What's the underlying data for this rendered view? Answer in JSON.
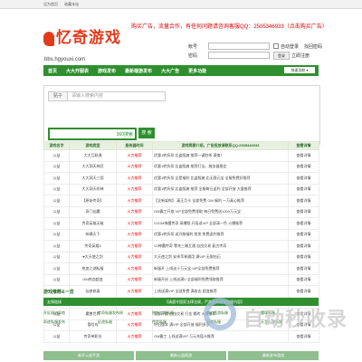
{
  "topbar": {
    "links": [
      "设为首页",
      "收藏本站"
    ]
  },
  "header": {
    "logo_text": "忆奇游戏",
    "domain": "bbs.hgyouxi.com",
    "ad": "购买广告，流量合作，有任何问题请咨询客服QQ：2505346933（点击购买广告）"
  },
  "login": {
    "account_label": "帐号",
    "password_label": "密码",
    "auto_login": "自动登录",
    "forgot": "找回密码",
    "login_button": "登录",
    "register": "立即注册"
  },
  "nav": {
    "items": [
      "首页",
      "大大开服表",
      "游戏发布",
      "最新端游发布",
      "大大广告",
      "更多功能"
    ],
    "quick": "快速导航 ▾"
  },
  "search": {
    "tag": "贴子",
    "placeholder": "请输入搜索内容",
    "engine": "360搜索",
    "button": "搜 索"
  },
  "table": {
    "headers": [
      "游戏名字",
      "游戏类型",
      "服务器时间",
      "游戏简要介绍，广告投放请联系QQ:2505346933",
      "查看详情"
    ],
    "rows": [
      [
        "公益",
        "大大互联通",
        "火力推荐",
        "优惠1转折扣 比盗版爽 推荐一键秒杀 满鬼！",
        "查看详情"
      ],
      [
        "公益",
        "大大洞天神武",
        "火力推荐",
        "优惠1转折扣 比盗版爽 推荐打宝，服务器稳定",
        "查看详情"
      ],
      [
        "公益",
        "大大洞天三国",
        "火力推荐",
        "优惠1转折扣 全是福利 比盗版爽 比无限元宝 全服免费好推荐",
        "查看详情"
      ],
      [
        "公益",
        "大大洞天的神",
        "火力推荐",
        "优惠1转折扣 比盗版爽 推荐 全服每日返利 全部开放 大量推荐",
        "查看详情"
      ],
      [
        "公益",
        "【原始传奇】",
        "火力推荐",
        "【全新架构】 真正月卡 全部免费 GM 福利 一万真心推荐",
        "查看详情"
      ],
      [
        "公益",
        "奇门仙魔",
        "火力推荐",
        "GM霸工开放 VIP全部免费领取 每日免费送1000万元宝",
        "查看详情"
      ],
      [
        "公益",
        "传奇英雄无敌",
        "火力推荐",
        "V2GM神魔传奇 高爆版 开局送VIP 全部清一色 火爆推荐",
        "查看详情"
      ],
      [
        "公益",
        "纵横天下",
        "火力推荐",
        "优惠1转折扣 送开服福利 首发 免费返利推荐",
        "查看详情"
      ],
      [
        "公益",
        "传奇英雄3",
        "火力推荐",
        "V2神魔传奇 零充三端互通 自由交易 复古传奇",
        "查看详情"
      ],
      [
        "公益",
        "♥大天使之剑",
        "火力推荐",
        "大天使之剑 安卓苹果通用 满VIP 无限钻石",
        "查看详情"
      ],
      [
        "公益",
        "热血江湖私服",
        "火力推荐",
        "新服开 上线送十万元宝 VIP全部免费推荐",
        "查看详情"
      ],
      [
        "公益",
        "GM热血超变",
        "火力推荐",
        "新服开启 上线送满V 全部福利免费领取推荐",
        "查看详情"
      ],
      [
        "公益",
        "仙侠修真",
        "火力推荐",
        "上线送满VIP 全部免费 满攻击 超变推荐",
        "查看详情"
      ],
      [
        "公益",
        "原神玩家",
        "火力推荐",
        "【公益优惠】【公益 元宝】【GM助手】无限元宝 火爆推荐",
        "查看详情"
      ],
      [
        "公益",
        "魔兽世界",
        "火力推荐",
        "全部开放 自由交易 打金 搬砖 火爆推荐",
        "查看详情"
      ],
      [
        "公益",
        "冒险岛",
        "火力推荐",
        "怀旧版本 满VIP 全部开放 福利多多",
        "查看详情"
      ],
      [
        "公益",
        "传奇单职业",
        "火力推荐",
        "GM霸工 上线送满VIP 万元充值卡推荐",
        "查看详情"
      ]
    ]
  },
  "friends": {
    "title": "游戏推荐&一览",
    "bar_label": "友情链接",
    "notice": "【请遵守国家法律法规，严禁发布违法违规内容】",
    "rows": [
      [
        "开区网站导航",
        "传奇私服发布网",
        "热血江湖私服",
        "梦幻西游私服",
        "魔域私服"
      ],
      [
        "奇迹私服发布",
        "征途私服",
        "传世私服",
        "问道私服",
        "天龙八部私服"
      ]
    ]
  },
  "bottom": {
    "labels": [
      "新开公益手游",
      "最新公益网游",
      "最新发布游戏"
    ]
  },
  "watermark": {
    "text": "自动秒收录"
  }
}
